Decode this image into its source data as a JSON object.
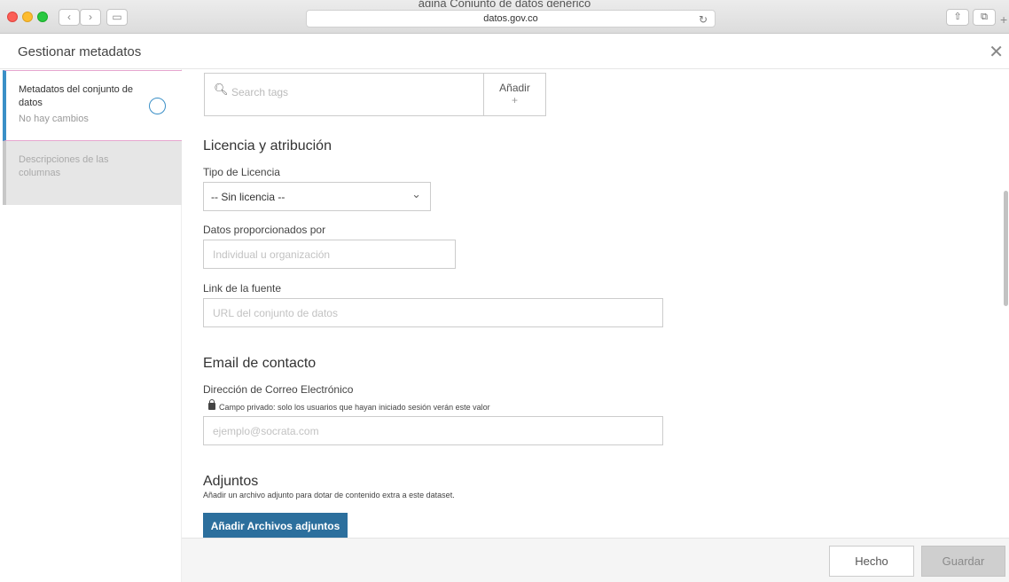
{
  "browser": {
    "page_title": "ágina Conjunto de datos generico",
    "url": "datos.gov.co",
    "back_glyph": "‹",
    "forward_glyph": "›",
    "sidebar_glyph": "▭",
    "reload_glyph": "↻",
    "share_glyph": "⇧",
    "tabs_glyph": "⧉",
    "newtab_glyph": "+"
  },
  "header": {
    "title": "Gestionar metadatos",
    "close_glyph": "✕"
  },
  "sidebar": {
    "items": [
      {
        "label": "Metadatos del conjunto de datos",
        "status": "No hay cambios",
        "active": true
      },
      {
        "label": "Descripciones de las columnas",
        "active": false
      }
    ]
  },
  "main": {
    "tags": {
      "placeholder": "Search tags",
      "add_label": "Añadir",
      "add_plus": "+"
    },
    "license_section": {
      "heading": "Licencia y atribución",
      "license_type_label": "Tipo de Licencia",
      "license_type_value": "-- Sin licencia --",
      "provided_by_label": "Datos proporcionados por",
      "provided_by_placeholder": "Individual u organización",
      "source_link_label": "Link de la fuente",
      "source_link_placeholder": "URL del conjunto de datos"
    },
    "contact_section": {
      "heading": "Email de contacto",
      "email_label": "Dirección de Correo Electrónico",
      "private_note": "Campo privado: solo los usuarios que hayan iniciado sesión verán este valor",
      "email_placeholder": "ejemplo@socrata.com"
    },
    "attachments_section": {
      "heading": "Adjuntos",
      "description": "Añadir un archivo adjunto para dotar de contenido extra a este dataset.",
      "button_label": "Añadir Archivos adjuntos"
    }
  },
  "footer": {
    "done_label": "Hecho",
    "save_label": "Guardar"
  },
  "colors": {
    "accent": "#3a8fc7",
    "primary_button": "#2c6f9d",
    "active_border": "#e6a6cf"
  }
}
